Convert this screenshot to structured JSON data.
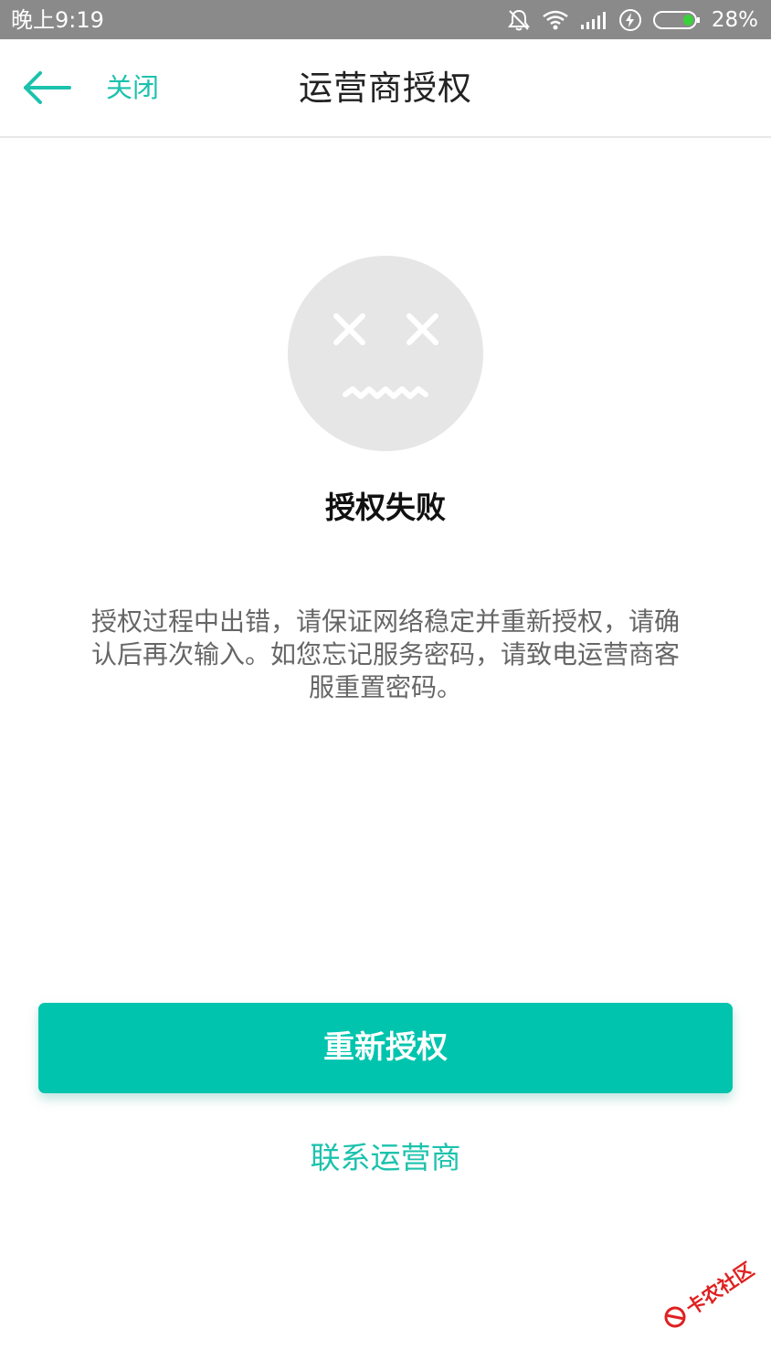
{
  "status_bar": {
    "time": "晚上9:19",
    "battery_percent": "28%",
    "icons": [
      "bell-muted-icon",
      "wifi-icon",
      "signal-icon",
      "charging-icon",
      "battery-icon"
    ]
  },
  "nav": {
    "back_icon": "arrow-left-icon",
    "close_label": "关闭",
    "title": "运营商授权"
  },
  "main": {
    "status_icon": "sad-face-icon",
    "title": "授权失败",
    "description": "授权过程中出错，请保证网络稳定并重新授权，请确认后再次输入。如您忘记服务密码，请致电运营商客服重置密码。"
  },
  "actions": {
    "retry_label": "重新授权",
    "contact_label": "联系运营商"
  },
  "watermark": {
    "text": "卡农社区"
  },
  "colors": {
    "accent": "#00c4ad",
    "link": "#1cc2ad",
    "status_bar": "#8a8a8a",
    "face": "#e6e6e6",
    "watermark": "#e02020"
  }
}
